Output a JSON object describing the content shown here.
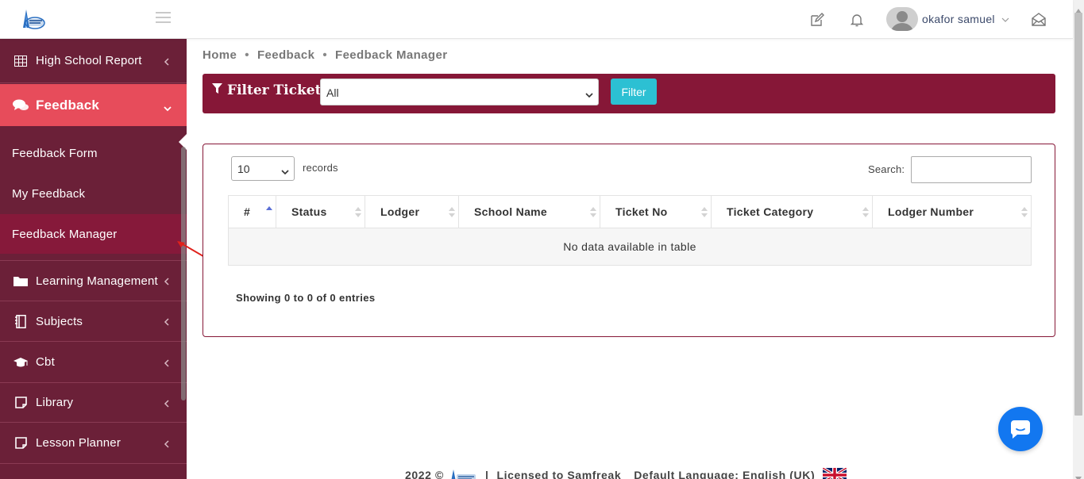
{
  "header": {
    "username": "okafor samuel"
  },
  "sidebar": {
    "items": [
      {
        "label": "High School Report",
        "icon": "table-icon"
      },
      {
        "label": "Feedback",
        "icon": "comments-icon"
      },
      {
        "label": "Learning Management",
        "icon": "folder-icon"
      },
      {
        "label": "Subjects",
        "icon": "notebook-icon"
      },
      {
        "label": "Cbt",
        "icon": "graduation-cap-icon"
      },
      {
        "label": "Library",
        "icon": "sticky-note-icon"
      },
      {
        "label": "Lesson Planner",
        "icon": "sticky-note-icon"
      }
    ],
    "subitems": [
      {
        "label": "Feedback Form"
      },
      {
        "label": "My Feedback"
      },
      {
        "label": "Feedback Manager"
      }
    ]
  },
  "breadcrumb": {
    "home": "Home",
    "feedback": "Feedback",
    "current": "Feedback Manager",
    "separator": "•"
  },
  "filter": {
    "title": "Filter Tickets",
    "selected": "All",
    "button": "Filter"
  },
  "table_controls": {
    "page_length": "10",
    "records_label": "records",
    "search_label": "Search:"
  },
  "table": {
    "columns": [
      "#",
      "Status",
      "Lodger",
      "School Name",
      "Ticket No",
      "Ticket Category",
      "Lodger Number"
    ],
    "empty_message": "No data available in table",
    "info": "Showing 0 to 0 of 0 entries"
  },
  "footer": {
    "year": "2022 ©",
    "separator": "|",
    "license": "Licensed to Samfreak",
    "language": "Default Language: English (UK)"
  },
  "colors": {
    "sidebar_bg": "#6b2038",
    "active_item": "#e74c5b",
    "brand_maroon": "#861737",
    "filter_button": "#2cc0d3",
    "chat_button": "#1277f0"
  }
}
